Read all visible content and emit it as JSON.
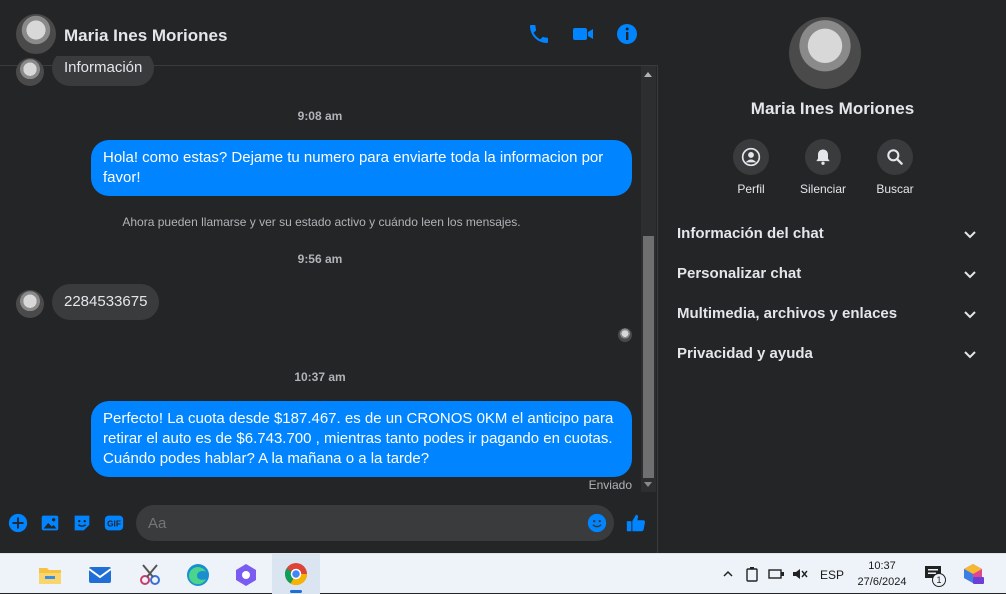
{
  "contact": {
    "name": "Maria Ines Moriones"
  },
  "messages": {
    "partial_top": "Información",
    "time1": "9:08 am",
    "out1": "Hola! como estas? Dejame tu numero para enviarte toda la informacion por favor!",
    "system": "Ahora pueden llamarse y ver su estado activo y cuándo leen los mensajes.",
    "time2": "9:56 am",
    "in1": "2284533675",
    "time3": "10:37 am",
    "out2": "Perfecto! La cuota desde $187.467. es de un CRONOS 0KM el anticipo para retirar el auto es de $6.743.700 , mientras tanto podes ir pagando en cuotas. Cuándo podes hablar? A la mañana o a la tarde?",
    "status": "Enviado"
  },
  "composer": {
    "placeholder": "Aa"
  },
  "info_panel": {
    "actions": [
      {
        "label": "Perfil",
        "icon": "profile-icon"
      },
      {
        "label": "Silenciar",
        "icon": "bell-icon"
      },
      {
        "label": "Buscar",
        "icon": "search-icon"
      }
    ],
    "sections": [
      {
        "label": "Información del chat"
      },
      {
        "label": "Personalizar chat"
      },
      {
        "label": "Multimedia, archivos y enlaces"
      },
      {
        "label": "Privacidad y ayuda"
      }
    ]
  },
  "taskbar": {
    "lang": "ESP",
    "time": "10:37",
    "date": "27/6/2024",
    "notif_count": "1"
  },
  "colors": {
    "accent": "#0084ff",
    "background": "#242526",
    "bubble_in": "#3a3b3c"
  }
}
